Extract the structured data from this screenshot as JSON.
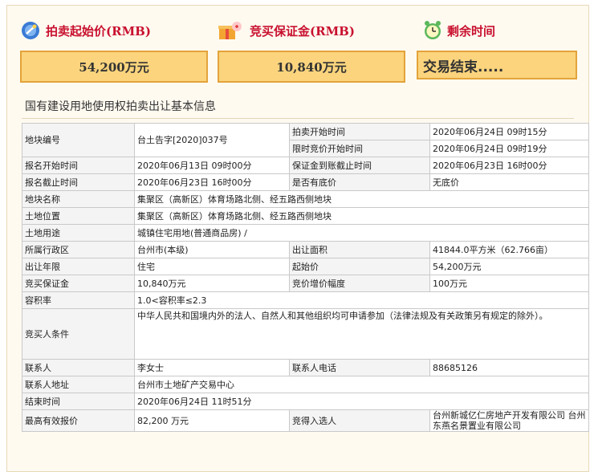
{
  "header": {
    "start_price_label": "拍卖起始价(RMB)",
    "deposit_label": "竞买保证金(RMB)",
    "remaining_label": "剩余时间",
    "start_price_value": "54,200万元",
    "deposit_value": "10,840万元",
    "remaining_value": "交易结束....."
  },
  "section_title": "国有建设用地使用权拍卖出让基本信息",
  "table": {
    "plot_no_label": "地块编号",
    "plot_no_value": "台土告字[2020]037号",
    "auction_start_label": "拍卖开始时间",
    "auction_start_value": "2020年06月24日 09时15分",
    "bid_start_label": "限时竞价开始时间",
    "bid_start_value": "2020年06月24日 09时19分",
    "reg_start_label": "报名开始时间",
    "reg_start_value": "2020年06月13日 09时00分",
    "deposit_deadline_label": "保证金到账截止时间",
    "deposit_deadline_value": "2020年06月23日 16时00分",
    "reg_end_label": "报名截止时间",
    "reg_end_value": "2020年06月23日 16时00分",
    "reserve_label": "是否有底价",
    "reserve_value": "无底价",
    "plot_name_label": "地块名称",
    "plot_name_value": "集聚区（高新区）体育场路北侧、经五路西侧地块",
    "location_label": "土地位置",
    "location_value": "集聚区（高新区）体育场路北侧、经五路西侧地块",
    "usage_label": "土地用途",
    "usage_value": "城镇住宅用地(普通商品房) /",
    "district_label": "所属行政区",
    "district_value": "台州市(本级)",
    "area_label": "出让面积",
    "area_value": "41844.0平方米（62.766亩）",
    "term_label": "出让年限",
    "term_value": "住宅",
    "start_price_label": "起始价",
    "start_price_value": "54,200万元",
    "deposit_label": "竞买保证金",
    "deposit_value": "10,840万元",
    "increment_label": "竞价增价幅度",
    "increment_value": "100万元",
    "far_label": "容积率",
    "far_value": "1.0<容积率≤2.3",
    "bidder_label": "竞买人条件",
    "bidder_value": "中华人民共和国境内外的法人、自然人和其他组织均可申请参加（法律法规及有关政策另有规定的除外）。",
    "contact_label": "联系人",
    "contact_value": "李女士",
    "phone_label": "联系人电话",
    "phone_value": "88685126",
    "address_label": "联系人地址",
    "address_value": "台州市土地矿产交易中心",
    "end_time_label": "结束时间",
    "end_time_value": "2020年06月24日 11时51分",
    "highest_bid_label": "最高有效报价",
    "highest_bid_value": "82,200 万元",
    "winner_label": "竞得入选人",
    "winner_value": "台州新城亿仁房地产开发有限公司 台州东燕名景置业有限公司"
  }
}
